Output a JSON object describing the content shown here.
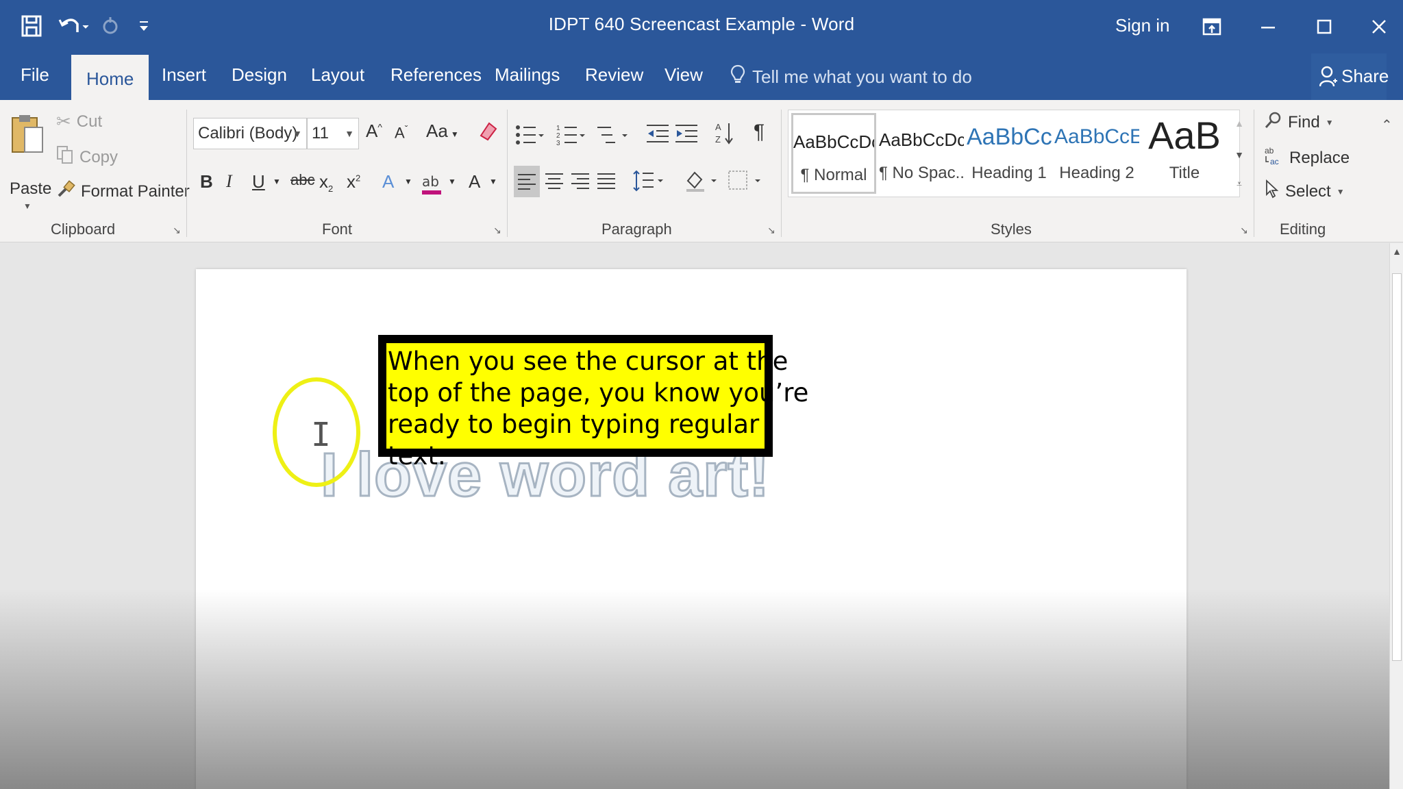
{
  "titlebar": {
    "doc_title": "IDPT 640 Screencast Example  -  Word",
    "signin": "Sign in",
    "qat_save_icon": "save-icon",
    "qat_undo_icon": "undo-icon",
    "qat_redo_icon": "redo-icon",
    "qat_customize_icon": "customize-qat-icon"
  },
  "tabs": [
    "File",
    "Home",
    "Insert",
    "Design",
    "Layout",
    "References",
    "Mailings",
    "Review",
    "View"
  ],
  "tellme": "Tell me what you want to do",
  "share": "Share",
  "clipboard": {
    "paste": "Paste",
    "cut": "Cut",
    "copy": "Copy",
    "format_painter": "Format Painter",
    "label": "Clipboard"
  },
  "font": {
    "name": "Calibri (Body)",
    "size": "11",
    "change_case": "Aa",
    "label": "Font"
  },
  "paragraph": {
    "label": "Paragraph"
  },
  "styles": {
    "label": "Styles",
    "items": [
      {
        "preview": "AaBbCcDc",
        "name": "¶ Normal"
      },
      {
        "preview": "AaBbCcDc",
        "name": "¶ No Spac..."
      },
      {
        "preview": "AaBbCc",
        "name": "Heading 1"
      },
      {
        "preview": "AaBbCcE",
        "name": "Heading 2"
      },
      {
        "preview": "AaB",
        "name": "Title"
      }
    ]
  },
  "editing": {
    "find": "Find",
    "replace": "Replace",
    "select": "Select",
    "label": "Editing"
  },
  "document": {
    "wordart": "I love word art!",
    "callout": "When you see the cursor at the\ntop of the page, you know you’re\nready to begin typing regular text."
  },
  "colors": {
    "titlebar": "#2b579a",
    "callout_bg": "#ffff00",
    "callout_border": "#000000",
    "highlight_circle": "#eef015"
  }
}
